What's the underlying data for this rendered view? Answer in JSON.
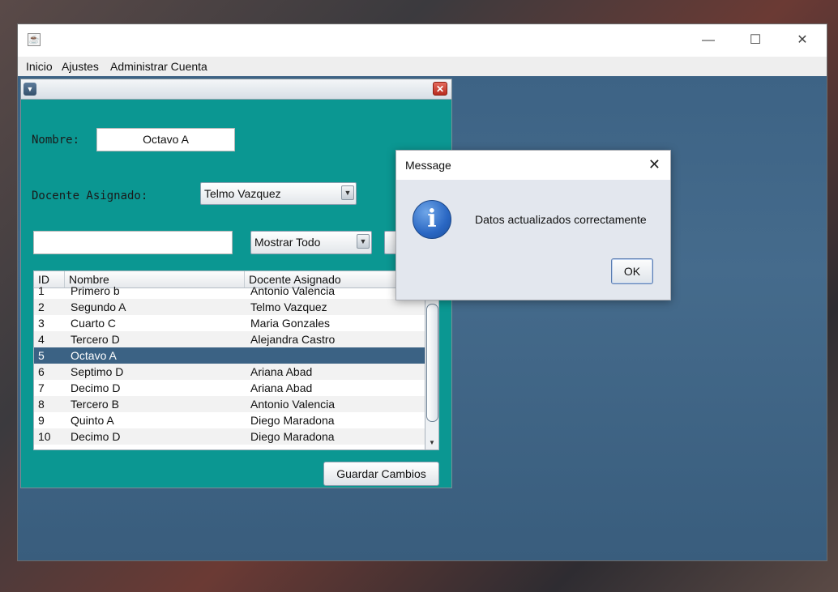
{
  "window": {
    "minimize_glyph": "—",
    "maximize_glyph": "☐",
    "close_glyph": "✕"
  },
  "menubar": {
    "items": [
      "Inicio",
      "Ajustes",
      "Administrar Cuenta"
    ]
  },
  "form": {
    "nombre_label": "Nombre:",
    "nombre_value": "Octavo A",
    "docente_label": "Docente Asignado:",
    "docente_value": "Telmo Vazquez",
    "search_value": "",
    "filter_value": "Mostrar Todo",
    "save_button": "Guardar Cambios"
  },
  "table": {
    "columns": [
      "ID",
      "Nombre",
      "Docente Asignado"
    ],
    "rows": [
      {
        "id": "1",
        "nombre": "Primero b",
        "docente": "Antonio Valencia"
      },
      {
        "id": "2",
        "nombre": "Segundo A",
        "docente": "Telmo Vazquez"
      },
      {
        "id": "3",
        "nombre": "Cuarto C",
        "docente": "Maria Gonzales"
      },
      {
        "id": "4",
        "nombre": "Tercero D",
        "docente": "Alejandra Castro"
      },
      {
        "id": "5",
        "nombre": "Octavo A",
        "docente": ""
      },
      {
        "id": "6",
        "nombre": "Septimo D",
        "docente": "Ariana Abad"
      },
      {
        "id": "7",
        "nombre": "Decimo D",
        "docente": "Ariana Abad"
      },
      {
        "id": "8",
        "nombre": "Tercero B",
        "docente": "Antonio Valencia"
      },
      {
        "id": "9",
        "nombre": "Quinto A",
        "docente": "Diego Maradona"
      },
      {
        "id": "10",
        "nombre": "Decimo D",
        "docente": "Diego Maradona"
      }
    ],
    "selected_row_id": "5"
  },
  "dialog": {
    "title": "Message",
    "message": "Datos actualizados correctamente",
    "ok_label": "OK",
    "icon": "info-icon"
  },
  "colors": {
    "form_background": "#0b9792",
    "selected_row": "#3b6284",
    "desktop": "#456b8c"
  }
}
